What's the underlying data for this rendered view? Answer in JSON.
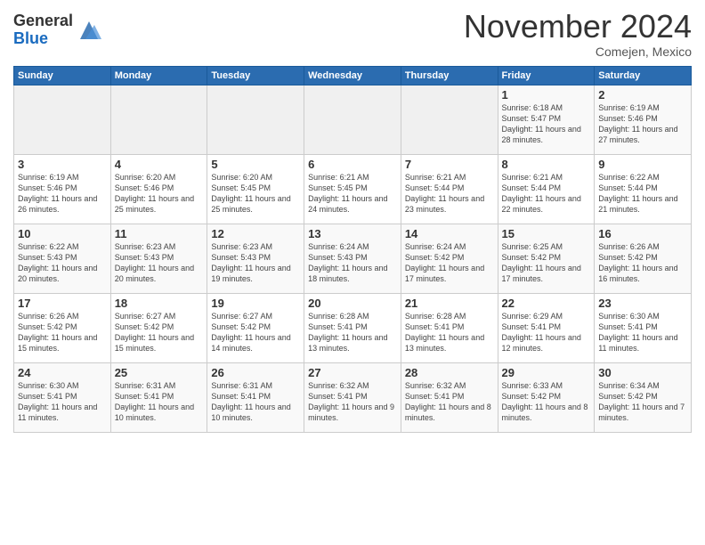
{
  "header": {
    "logo_line1": "General",
    "logo_line2": "Blue",
    "month_title": "November 2024",
    "location": "Comejen, Mexico"
  },
  "days_of_week": [
    "Sunday",
    "Monday",
    "Tuesday",
    "Wednesday",
    "Thursday",
    "Friday",
    "Saturday"
  ],
  "weeks": [
    [
      {
        "day": "",
        "empty": true
      },
      {
        "day": "",
        "empty": true
      },
      {
        "day": "",
        "empty": true
      },
      {
        "day": "",
        "empty": true
      },
      {
        "day": "",
        "empty": true
      },
      {
        "day": "1",
        "sunrise": "Sunrise: 6:18 AM",
        "sunset": "Sunset: 5:47 PM",
        "daylight": "Daylight: 11 hours and 28 minutes."
      },
      {
        "day": "2",
        "sunrise": "Sunrise: 6:19 AM",
        "sunset": "Sunset: 5:46 PM",
        "daylight": "Daylight: 11 hours and 27 minutes."
      }
    ],
    [
      {
        "day": "3",
        "sunrise": "Sunrise: 6:19 AM",
        "sunset": "Sunset: 5:46 PM",
        "daylight": "Daylight: 11 hours and 26 minutes."
      },
      {
        "day": "4",
        "sunrise": "Sunrise: 6:20 AM",
        "sunset": "Sunset: 5:46 PM",
        "daylight": "Daylight: 11 hours and 25 minutes."
      },
      {
        "day": "5",
        "sunrise": "Sunrise: 6:20 AM",
        "sunset": "Sunset: 5:45 PM",
        "daylight": "Daylight: 11 hours and 25 minutes."
      },
      {
        "day": "6",
        "sunrise": "Sunrise: 6:21 AM",
        "sunset": "Sunset: 5:45 PM",
        "daylight": "Daylight: 11 hours and 24 minutes."
      },
      {
        "day": "7",
        "sunrise": "Sunrise: 6:21 AM",
        "sunset": "Sunset: 5:44 PM",
        "daylight": "Daylight: 11 hours and 23 minutes."
      },
      {
        "day": "8",
        "sunrise": "Sunrise: 6:21 AM",
        "sunset": "Sunset: 5:44 PM",
        "daylight": "Daylight: 11 hours and 22 minutes."
      },
      {
        "day": "9",
        "sunrise": "Sunrise: 6:22 AM",
        "sunset": "Sunset: 5:44 PM",
        "daylight": "Daylight: 11 hours and 21 minutes."
      }
    ],
    [
      {
        "day": "10",
        "sunrise": "Sunrise: 6:22 AM",
        "sunset": "Sunset: 5:43 PM",
        "daylight": "Daylight: 11 hours and 20 minutes."
      },
      {
        "day": "11",
        "sunrise": "Sunrise: 6:23 AM",
        "sunset": "Sunset: 5:43 PM",
        "daylight": "Daylight: 11 hours and 20 minutes."
      },
      {
        "day": "12",
        "sunrise": "Sunrise: 6:23 AM",
        "sunset": "Sunset: 5:43 PM",
        "daylight": "Daylight: 11 hours and 19 minutes."
      },
      {
        "day": "13",
        "sunrise": "Sunrise: 6:24 AM",
        "sunset": "Sunset: 5:43 PM",
        "daylight": "Daylight: 11 hours and 18 minutes."
      },
      {
        "day": "14",
        "sunrise": "Sunrise: 6:24 AM",
        "sunset": "Sunset: 5:42 PM",
        "daylight": "Daylight: 11 hours and 17 minutes."
      },
      {
        "day": "15",
        "sunrise": "Sunrise: 6:25 AM",
        "sunset": "Sunset: 5:42 PM",
        "daylight": "Daylight: 11 hours and 17 minutes."
      },
      {
        "day": "16",
        "sunrise": "Sunrise: 6:26 AM",
        "sunset": "Sunset: 5:42 PM",
        "daylight": "Daylight: 11 hours and 16 minutes."
      }
    ],
    [
      {
        "day": "17",
        "sunrise": "Sunrise: 6:26 AM",
        "sunset": "Sunset: 5:42 PM",
        "daylight": "Daylight: 11 hours and 15 minutes."
      },
      {
        "day": "18",
        "sunrise": "Sunrise: 6:27 AM",
        "sunset": "Sunset: 5:42 PM",
        "daylight": "Daylight: 11 hours and 15 minutes."
      },
      {
        "day": "19",
        "sunrise": "Sunrise: 6:27 AM",
        "sunset": "Sunset: 5:42 PM",
        "daylight": "Daylight: 11 hours and 14 minutes."
      },
      {
        "day": "20",
        "sunrise": "Sunrise: 6:28 AM",
        "sunset": "Sunset: 5:41 PM",
        "daylight": "Daylight: 11 hours and 13 minutes."
      },
      {
        "day": "21",
        "sunrise": "Sunrise: 6:28 AM",
        "sunset": "Sunset: 5:41 PM",
        "daylight": "Daylight: 11 hours and 13 minutes."
      },
      {
        "day": "22",
        "sunrise": "Sunrise: 6:29 AM",
        "sunset": "Sunset: 5:41 PM",
        "daylight": "Daylight: 11 hours and 12 minutes."
      },
      {
        "day": "23",
        "sunrise": "Sunrise: 6:30 AM",
        "sunset": "Sunset: 5:41 PM",
        "daylight": "Daylight: 11 hours and 11 minutes."
      }
    ],
    [
      {
        "day": "24",
        "sunrise": "Sunrise: 6:30 AM",
        "sunset": "Sunset: 5:41 PM",
        "daylight": "Daylight: 11 hours and 11 minutes."
      },
      {
        "day": "25",
        "sunrise": "Sunrise: 6:31 AM",
        "sunset": "Sunset: 5:41 PM",
        "daylight": "Daylight: 11 hours and 10 minutes."
      },
      {
        "day": "26",
        "sunrise": "Sunrise: 6:31 AM",
        "sunset": "Sunset: 5:41 PM",
        "daylight": "Daylight: 11 hours and 10 minutes."
      },
      {
        "day": "27",
        "sunrise": "Sunrise: 6:32 AM",
        "sunset": "Sunset: 5:41 PM",
        "daylight": "Daylight: 11 hours and 9 minutes."
      },
      {
        "day": "28",
        "sunrise": "Sunrise: 6:32 AM",
        "sunset": "Sunset: 5:41 PM",
        "daylight": "Daylight: 11 hours and 8 minutes."
      },
      {
        "day": "29",
        "sunrise": "Sunrise: 6:33 AM",
        "sunset": "Sunset: 5:42 PM",
        "daylight": "Daylight: 11 hours and 8 minutes."
      },
      {
        "day": "30",
        "sunrise": "Sunrise: 6:34 AM",
        "sunset": "Sunset: 5:42 PM",
        "daylight": "Daylight: 11 hours and 7 minutes."
      }
    ]
  ]
}
